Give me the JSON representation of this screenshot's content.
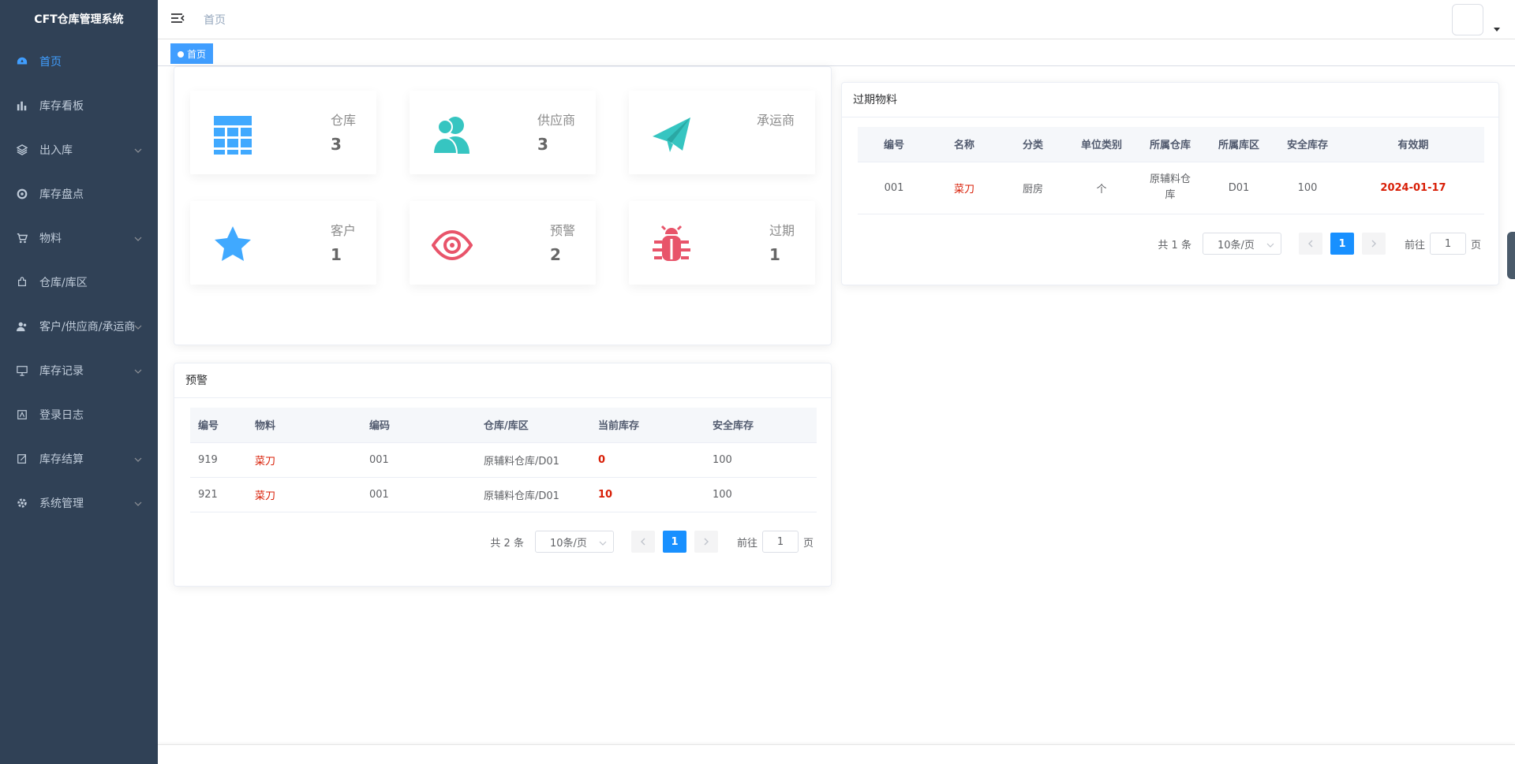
{
  "app_title": "CFT仓库管理系统",
  "sidebar": {
    "items": [
      {
        "label": "首页",
        "icon": "dashboard-icon",
        "expandable": false,
        "active": true
      },
      {
        "label": "库存看板",
        "icon": "bar-chart-icon",
        "expandable": false
      },
      {
        "label": "出入库",
        "icon": "layers-icon",
        "expandable": true
      },
      {
        "label": "库存盘点",
        "icon": "aperture-icon",
        "expandable": false
      },
      {
        "label": "物料",
        "icon": "cart-icon",
        "expandable": true
      },
      {
        "label": "仓库/库区",
        "icon": "puzzle-icon",
        "expandable": false
      },
      {
        "label": "客户/供应商/承运商",
        "icon": "user-icon",
        "expandable": true
      },
      {
        "label": "库存记录",
        "icon": "monitor-icon",
        "expandable": true
      },
      {
        "label": "登录日志",
        "icon": "log-icon",
        "expandable": false
      },
      {
        "label": "库存结算",
        "icon": "edit-icon",
        "expandable": true
      },
      {
        "label": "系统管理",
        "icon": "gear-icon",
        "expandable": true
      }
    ]
  },
  "navbar": {
    "breadcrumb": "首页"
  },
  "tagsview": {
    "tags": [
      {
        "label": "首页",
        "active": true
      }
    ]
  },
  "stats": [
    {
      "label": "仓库",
      "value": "3",
      "icon": "table-icon",
      "color": "#40a9ff"
    },
    {
      "label": "供应商",
      "value": "3",
      "icon": "people-icon",
      "color": "#36c5c1"
    },
    {
      "label": "承运商",
      "value": "",
      "icon": "paper-plane-icon",
      "color": "#36c5c1"
    },
    {
      "label": "客户",
      "value": "1",
      "icon": "star-icon",
      "color": "#40a9ff"
    },
    {
      "label": "预警",
      "value": "2",
      "icon": "eye-icon",
      "color": "#e8546a"
    },
    {
      "label": "过期",
      "value": "1",
      "icon": "bug-icon",
      "color": "#e8546a"
    }
  ],
  "warning": {
    "title": "预警",
    "columns": [
      "编号",
      "物料",
      "编码",
      "仓库/库区",
      "当前库存",
      "安全库存"
    ],
    "rows": [
      {
        "id": "919",
        "material": "菜刀",
        "code": "001",
        "location": "原辅料仓库/D01",
        "current": "0",
        "safe": "100"
      },
      {
        "id": "921",
        "material": "菜刀",
        "code": "001",
        "location": "原辅料仓库/D01",
        "current": "10",
        "safe": "100"
      }
    ],
    "pager": {
      "total": "共 2 条",
      "size": "10条/页",
      "current": "1",
      "goto_prefix": "前往",
      "goto_value": "1",
      "goto_suffix": "页"
    }
  },
  "expired": {
    "title": "过期物料",
    "columns": [
      "编号",
      "名称",
      "分类",
      "单位类别",
      "所属仓库",
      "所属库区",
      "安全库存",
      "有效期"
    ],
    "rows": [
      {
        "id": "001",
        "name": "菜刀",
        "category": "厨房",
        "unit": "个",
        "warehouse": "原辅料仓库",
        "area": "D01",
        "safe": "100",
        "expiry": "2024-01-17"
      }
    ],
    "pager": {
      "total": "共 1 条",
      "size": "10条/页",
      "current": "1",
      "goto_prefix": "前往",
      "goto_value": "1",
      "goto_suffix": "页"
    }
  },
  "colors": {
    "sidebar_bg": "#304156",
    "accent": "#409eff",
    "danger": "#d81e06"
  }
}
